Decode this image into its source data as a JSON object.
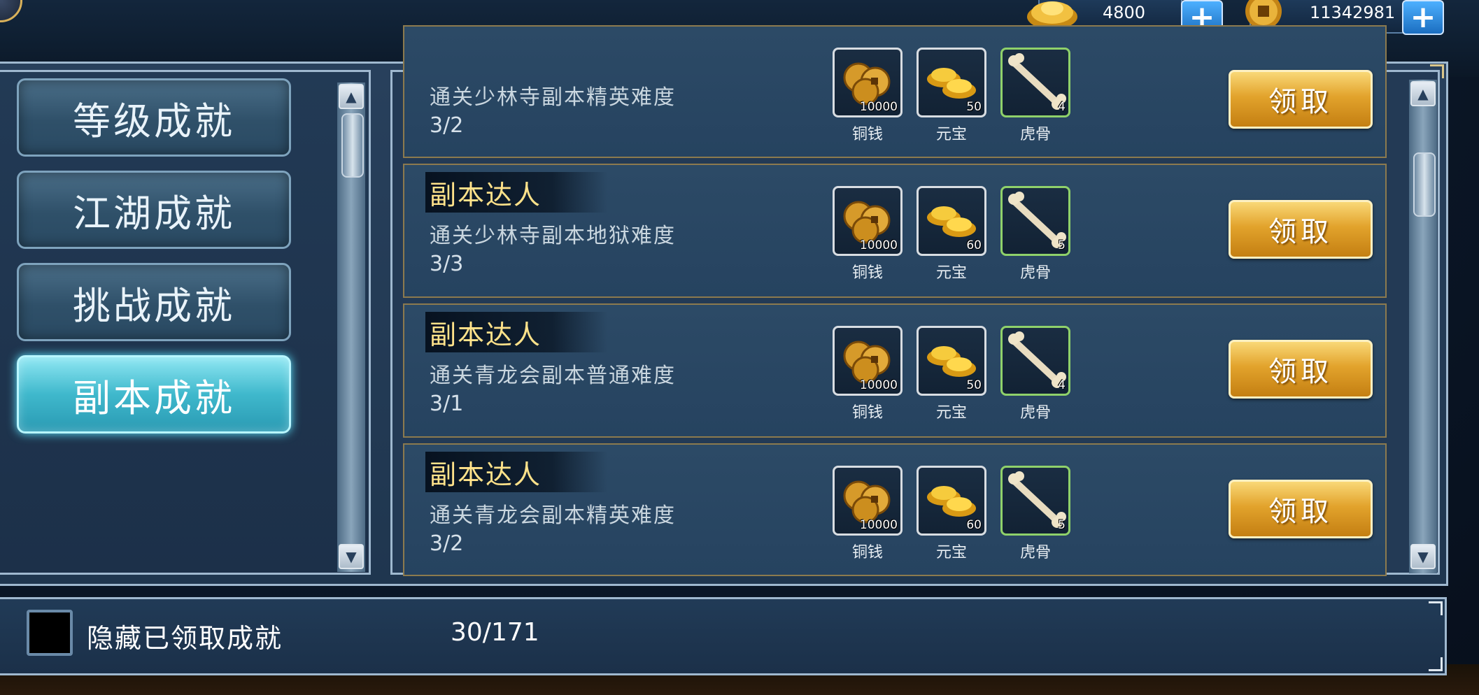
{
  "currency": {
    "ingots": {
      "icon": "gold-ingot-icon",
      "value": "4800"
    },
    "coins": {
      "icon": "copper-coin-icon",
      "value": "11342981"
    }
  },
  "categories": [
    {
      "label": "等级成就",
      "active": false
    },
    {
      "label": "江湖成就",
      "active": false
    },
    {
      "label": "挑战成就",
      "active": false
    },
    {
      "label": "副本成就",
      "active": true
    }
  ],
  "achievements": [
    {
      "title": "",
      "desc": "通关少林寺副本精英难度",
      "progress": "3/2",
      "rewards": [
        {
          "name": "铜钱",
          "qty": "10000",
          "icon": "copper-coins-icon"
        },
        {
          "name": "元宝",
          "qty": "50",
          "icon": "gold-ingots-icon"
        },
        {
          "name": "虎骨",
          "qty": "4",
          "icon": "tiger-bone-icon"
        }
      ],
      "button": "领取"
    },
    {
      "title": "副本达人",
      "desc": "通关少林寺副本地狱难度",
      "progress": "3/3",
      "rewards": [
        {
          "name": "铜钱",
          "qty": "10000",
          "icon": "copper-coins-icon"
        },
        {
          "name": "元宝",
          "qty": "60",
          "icon": "gold-ingots-icon"
        },
        {
          "name": "虎骨",
          "qty": "5",
          "icon": "tiger-bone-icon"
        }
      ],
      "button": "领取"
    },
    {
      "title": "副本达人",
      "desc": "通关青龙会副本普通难度",
      "progress": "3/1",
      "rewards": [
        {
          "name": "铜钱",
          "qty": "10000",
          "icon": "copper-coins-icon"
        },
        {
          "name": "元宝",
          "qty": "50",
          "icon": "gold-ingots-icon"
        },
        {
          "name": "虎骨",
          "qty": "4",
          "icon": "tiger-bone-icon"
        }
      ],
      "button": "领取"
    },
    {
      "title": "副本达人",
      "desc": "通关青龙会副本精英难度",
      "progress": "3/2",
      "rewards": [
        {
          "name": "铜钱",
          "qty": "10000",
          "icon": "copper-coins-icon"
        },
        {
          "name": "元宝",
          "qty": "60",
          "icon": "gold-ingots-icon"
        },
        {
          "name": "虎骨",
          "qty": "5",
          "icon": "tiger-bone-icon"
        }
      ],
      "button": "领取"
    }
  ],
  "footer": {
    "hide_claimed_label": "隐藏已领取成就",
    "count": "30/171"
  },
  "colors": {
    "title_gold": "#ffe28a",
    "claim_button": "#e2a32c",
    "active_tab": "#3fb8cc"
  }
}
